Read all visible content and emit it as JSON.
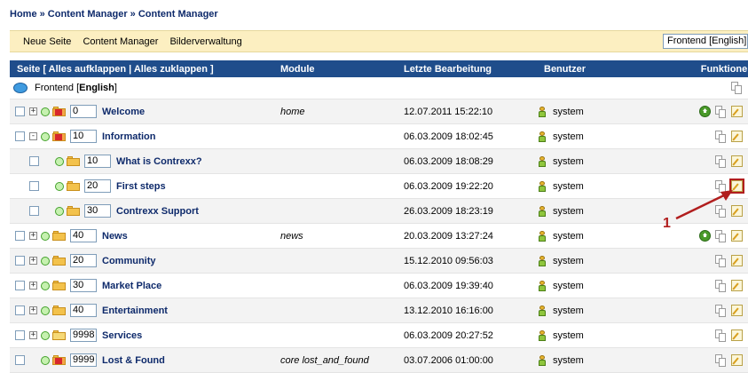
{
  "breadcrumb": "Home » Content Manager » Content Manager",
  "toolbar": {
    "links": [
      "Neue Seite",
      "Content Manager",
      "Bilderverwaltung"
    ],
    "language_select": "Frontend [English]"
  },
  "table": {
    "headers": {
      "seite": "Seite  [ Alles aufklappen | Alles zuklappen ]",
      "module": "Module",
      "letzte": "Letzte Bearbeitung",
      "benutzer": "Benutzer",
      "funktionen": "Funktionen"
    },
    "root": {
      "prefix": "Frontend [",
      "lang": "English",
      "suffix": "]"
    },
    "rows": [
      {
        "order": "0",
        "title": "Welcome",
        "module": "home",
        "date": "12.07.2011 15:22:10",
        "user": "system"
      },
      {
        "order": "10",
        "title": "Information",
        "module": "",
        "date": "06.03.2009 18:02:45",
        "user": "system"
      },
      {
        "order": "10",
        "title": "What is Contrexx?",
        "module": "",
        "date": "06.03.2009 18:08:29",
        "user": "system"
      },
      {
        "order": "20",
        "title": "First steps",
        "module": "",
        "date": "06.03.2009 19:22:20",
        "user": "system"
      },
      {
        "order": "30",
        "title": "Contrexx Support",
        "module": "",
        "date": "26.03.2009 18:23:19",
        "user": "system"
      },
      {
        "order": "40",
        "title": "News",
        "module": "news",
        "date": "20.03.2009 13:27:24",
        "user": "system"
      },
      {
        "order": "20",
        "title": "Community",
        "module": "",
        "date": "15.12.2010 09:56:03",
        "user": "system"
      },
      {
        "order": "30",
        "title": "Market Place",
        "module": "",
        "date": "06.03.2009 19:39:40",
        "user": "system"
      },
      {
        "order": "40",
        "title": "Entertainment",
        "module": "",
        "date": "13.12.2010 16:16:00",
        "user": "system"
      },
      {
        "order": "9998",
        "title": "Services",
        "module": "",
        "date": "06.03.2009 20:27:52",
        "user": "system"
      },
      {
        "order": "9999",
        "title": "Lost & Found",
        "module": "core lost_and_found",
        "date": "03.07.2006 01:00:00",
        "user": "system"
      }
    ]
  },
  "annotation": "1",
  "colors": {
    "header_bg": "#1f4d8b",
    "toolbar_bg": "#fcefc1",
    "link": "#0e2a6b",
    "annotation": "#b11e1e"
  }
}
